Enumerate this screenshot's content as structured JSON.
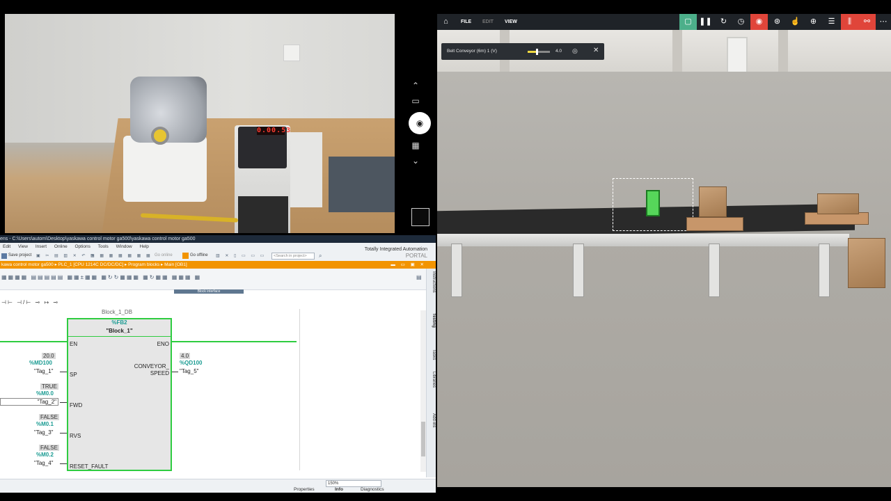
{
  "camera": {
    "vfd_display": "0.00.53",
    "controls": [
      {
        "icon": "chevron-up-icon"
      },
      {
        "icon": "video-icon"
      },
      {
        "icon": "camera-icon"
      },
      {
        "icon": "qr-code-icon"
      },
      {
        "icon": "chevron-down-icon"
      }
    ]
  },
  "tia": {
    "title": "ens - C:\\Users\\autom\\Desktop\\yaskawa control motor ga500\\yaskawa control motor ga500",
    "menu": [
      "Edit",
      "View",
      "Insert",
      "Online",
      "Options",
      "Tools",
      "Window",
      "Help"
    ],
    "toolbar": {
      "save_label": "Save project",
      "go_online": "Go online",
      "go_offline": "Go offline",
      "search_placeholder": "<Search in project>"
    },
    "brand_line1": "Totally Integrated Automation",
    "brand_line2": "PORTAL",
    "breadcrumb": "kawa control motor ga500  ▸  PLC_1 [CPU 1214C DC/DC/DC]  ▸  Program blocks  ▸  Main [OB1]",
    "block_interface_tab": "Block interface",
    "sidebar_tabs": [
      "Instructions",
      "Testing",
      "Tasks",
      "Libraries",
      "Add-ins"
    ],
    "ladder": {
      "block_name_above": "Block_1_DB",
      "fb_address": "%FB2",
      "fb_name": "\"Block_1\"",
      "pins_left": [
        "EN",
        "SP",
        "FWD",
        "RVS",
        "RESET_FAULT"
      ],
      "pins_right": [
        "ENO",
        "CONVEYOR_",
        "SPEED"
      ],
      "inputs": [
        {
          "value": "20.0",
          "address": "%MD100",
          "tag": "\"Tag_1\""
        },
        {
          "value": "TRUE",
          "address": "%M0.0",
          "tag": "\"Tag_2\""
        },
        {
          "value": "FALSE",
          "address": "%M0.1",
          "tag": "\"Tag_3\""
        },
        {
          "value": "FALSE",
          "address": "%M0.2",
          "tag": "\"Tag_4\""
        }
      ],
      "output": {
        "value": "4.0",
        "address": "%QD100",
        "tag": "\"Tag_5\""
      }
    },
    "zoom": "150%",
    "status_tabs": [
      "Properties",
      "Info",
      "Diagnostics"
    ]
  },
  "sim": {
    "menu": [
      "FILE",
      "EDIT",
      "VIEW"
    ],
    "toolbar_icons": [
      "home-icon",
      "select-icon",
      "pause-icon",
      "reset-icon",
      "timer-icon",
      "camera-record-icon",
      "sensor-icon",
      "hand-icon",
      "target-icon",
      "list-icon",
      "io-icon",
      "drivers-icon",
      "more-icon"
    ],
    "panel": {
      "label": "Belt Conveyor (6m) 1 (V)",
      "value": "4.0",
      "slider_fraction": 0.4
    }
  },
  "colors": {
    "accent_green": "#2ecc40",
    "tia_orange": "#f29400",
    "sim_red": "#e0453a",
    "sim_teal": "#4caf8a"
  }
}
